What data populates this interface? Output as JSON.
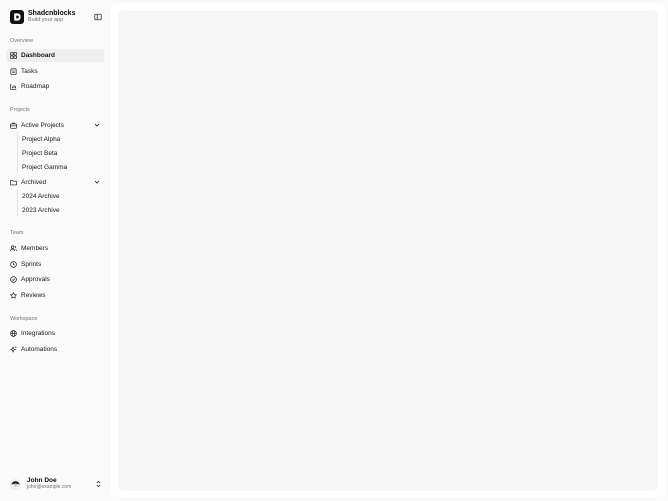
{
  "brand": {
    "name": "Shadcnblocks",
    "tagline": "Build your app"
  },
  "sections": {
    "overview": "Overview",
    "projects": "Projects",
    "team": "Team",
    "workspace": "Workspace"
  },
  "nav": {
    "dashboard": "Dashboard",
    "tasks": "Tasks",
    "roadmap": "Roadmap",
    "active_projects": "Active Projects",
    "archived": "Archived",
    "members": "Members",
    "sprints": "Sprints",
    "approvals": "Approvals",
    "reviews": "Reviews",
    "integrations": "Integrations",
    "automations": "Automations"
  },
  "active_projects_items": [
    "Project Alpha",
    "Project Beta",
    "Project Gamma"
  ],
  "archived_items": [
    "2024 Archive",
    "2023 Archive"
  ],
  "user": {
    "name": "John Doe",
    "email": "john@example.com"
  },
  "active_item": "dashboard",
  "colors": {
    "active_bg": "#efefef",
    "sidebar_bg": "#fafafa",
    "content_bg": "#f7f7f7"
  }
}
